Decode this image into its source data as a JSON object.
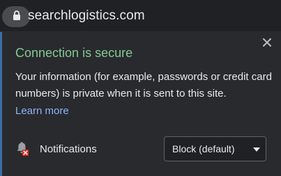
{
  "omnibox": {
    "url": "searchlogistics.com"
  },
  "bubble": {
    "title": "Connection is secure",
    "description": "Your information (for example, passwords or credit card numbers) is private when it is sent to this site.",
    "learn_more": "Learn more",
    "permissions": [
      {
        "label": "Notifications",
        "value": "Block (default)",
        "icon": "bell-blocked-icon"
      }
    ]
  },
  "colors": {
    "secure_title": "#81c995",
    "link": "#8ab4f8",
    "background": "#292a2d",
    "blocked_badge": "#d93025"
  }
}
